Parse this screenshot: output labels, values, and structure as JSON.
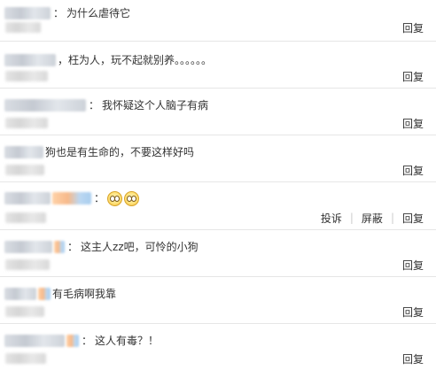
{
  "comments": [
    {
      "text": "为什么虐待它",
      "reply": "回复"
    },
    {
      "text": "，枉为人，玩不起就别养。。。。。。",
      "reply": "回复"
    },
    {
      "text": "我怀疑这个人脑子有病",
      "reply": "回复"
    },
    {
      "text": "狗也是有生命的，不要这样好吗",
      "reply": "回复"
    },
    {
      "text": "",
      "report": "投诉",
      "block": "屏蔽",
      "reply": "回复"
    },
    {
      "text": "这主人zz吧，可怜的小狗",
      "reply": "回复"
    },
    {
      "text": "有毛病啊我靠",
      "reply": "回复"
    },
    {
      "text": "这人有毒？！",
      "reply": "回复"
    }
  ],
  "separators": {
    "colon": "："
  },
  "icons": {
    "emoji": "smiley-face-icon"
  },
  "colors": {
    "text": "#333333",
    "divider": "#e6e6e6",
    "action_separator": "#cccccc"
  }
}
